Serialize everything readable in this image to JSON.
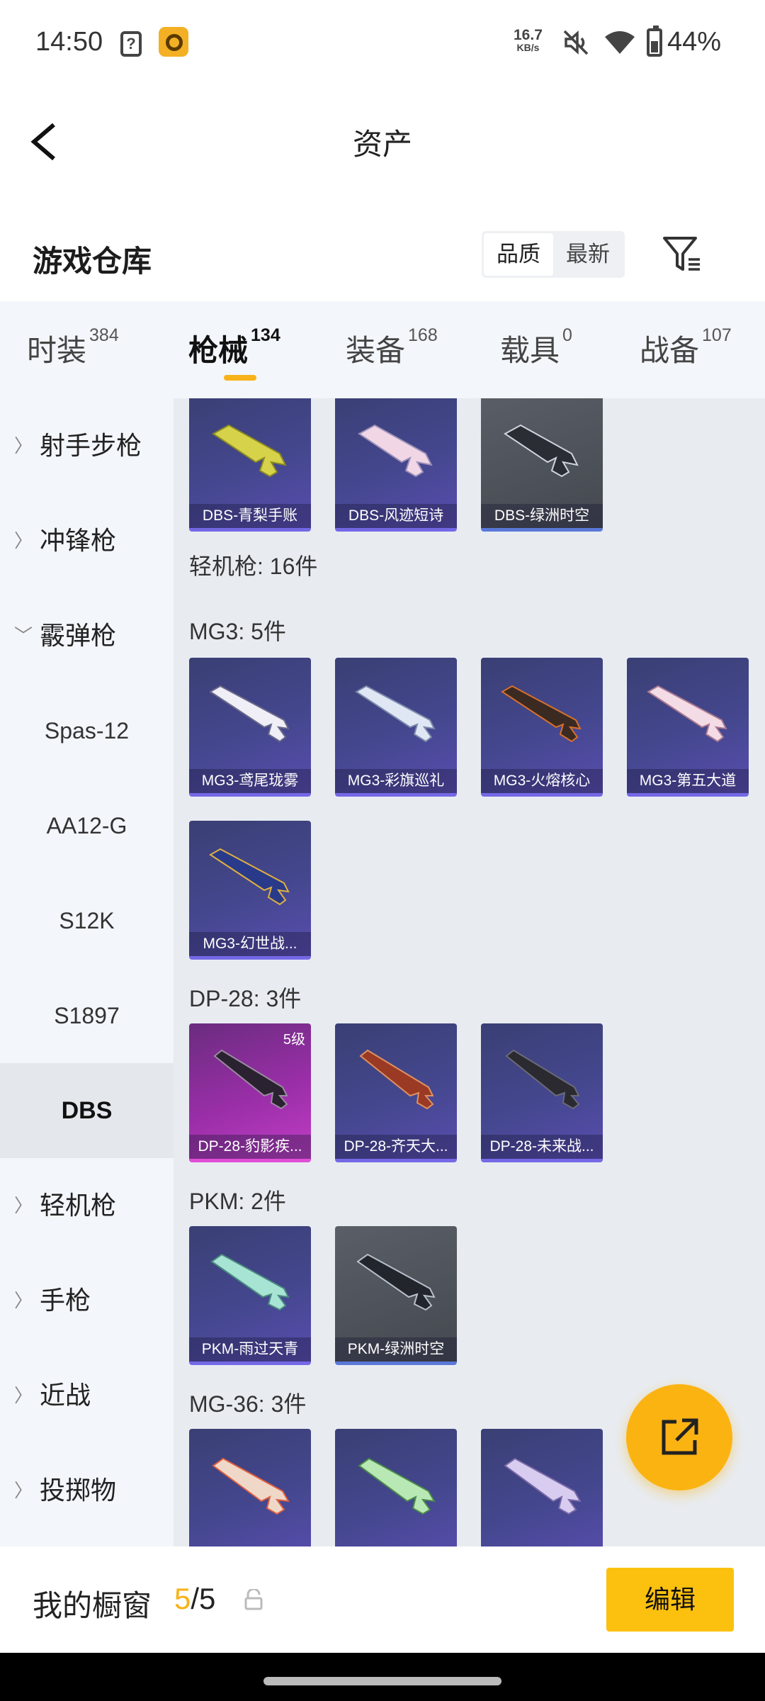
{
  "status": {
    "time": "14:50",
    "sim": "?",
    "speed_top": "16.7",
    "speed_unit": "KB/s",
    "battery": "44%"
  },
  "header": {
    "title": "资产"
  },
  "section": {
    "title": "游戏仓库",
    "sort_quality": "品质",
    "sort_latest": "最新"
  },
  "tabs": [
    {
      "label": "时装",
      "count": "384"
    },
    {
      "label": "枪械",
      "count": "134"
    },
    {
      "label": "装备",
      "count": "168"
    },
    {
      "label": "载具",
      "count": "0"
    },
    {
      "label": "战备",
      "count": "107"
    }
  ],
  "sidebar": {
    "cat1": "射手步枪",
    "cat2": "冲锋枪",
    "cat3": "霰弹枪",
    "sub1": "Spas-12",
    "sub2": "AA12-G",
    "sub3": "S12K",
    "sub4": "S1897",
    "sub5": "DBS",
    "cat4": "轻机枪",
    "cat5": "手枪",
    "cat6": "近战",
    "cat7": "投掷物"
  },
  "content": {
    "row0": [
      "DBS-青梨手账",
      "DBS-风迹短诗",
      "DBS-绿洲时空"
    ],
    "lmg_header": "轻机枪: 16件",
    "mg3_header": "MG3: 5件",
    "mg3": [
      "MG3-鸢尾珑雾",
      "MG3-彩旗巡礼",
      "MG3-火熔核心",
      "MG3-第五大道",
      "MG3-幻世战..."
    ],
    "dp28_header": "DP-28: 3件",
    "dp28": [
      "DP-28-豹影疾...",
      "DP-28-齐天大...",
      "DP-28-未来战..."
    ],
    "dp28_level": "5级",
    "pkm_header": "PKM: 2件",
    "pkm": [
      "PKM-雨过天青",
      "PKM-绿洲时空"
    ],
    "mg36_header": "MG-36: 3件"
  },
  "bottom": {
    "label": "我的橱窗",
    "count_current": "5",
    "count_total": "/5",
    "edit": "编辑"
  }
}
